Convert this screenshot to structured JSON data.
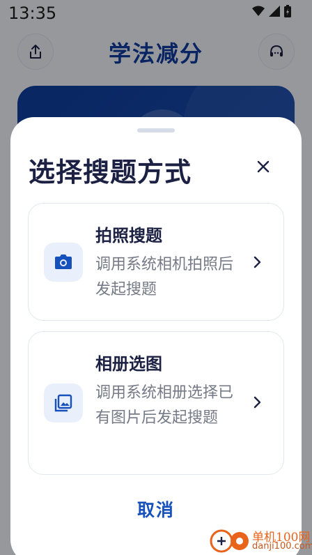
{
  "status_bar": {
    "time": "13:35"
  },
  "header": {
    "title": "学法减分",
    "share_icon": "share-icon",
    "service_icon": "customer-service-icon"
  },
  "sheet": {
    "title": "选择搜题方式",
    "close_icon": "close-icon",
    "options": [
      {
        "title": "拍照搜题",
        "description": "调用系统相机拍照后发起搜题",
        "icon": "camera-icon"
      },
      {
        "title": "相册选图",
        "description": "调用系统相册选择已有图片后发起搜题",
        "icon": "photo-album-icon"
      }
    ],
    "cancel_label": "取消"
  },
  "watermark": {
    "name": "单机100网",
    "url": "danji100.com"
  },
  "colors": {
    "brand_blue": "#0d3a9e",
    "accent_blue": "#1550bd",
    "title_dark": "#1c2143",
    "text_gray": "#747a86"
  }
}
